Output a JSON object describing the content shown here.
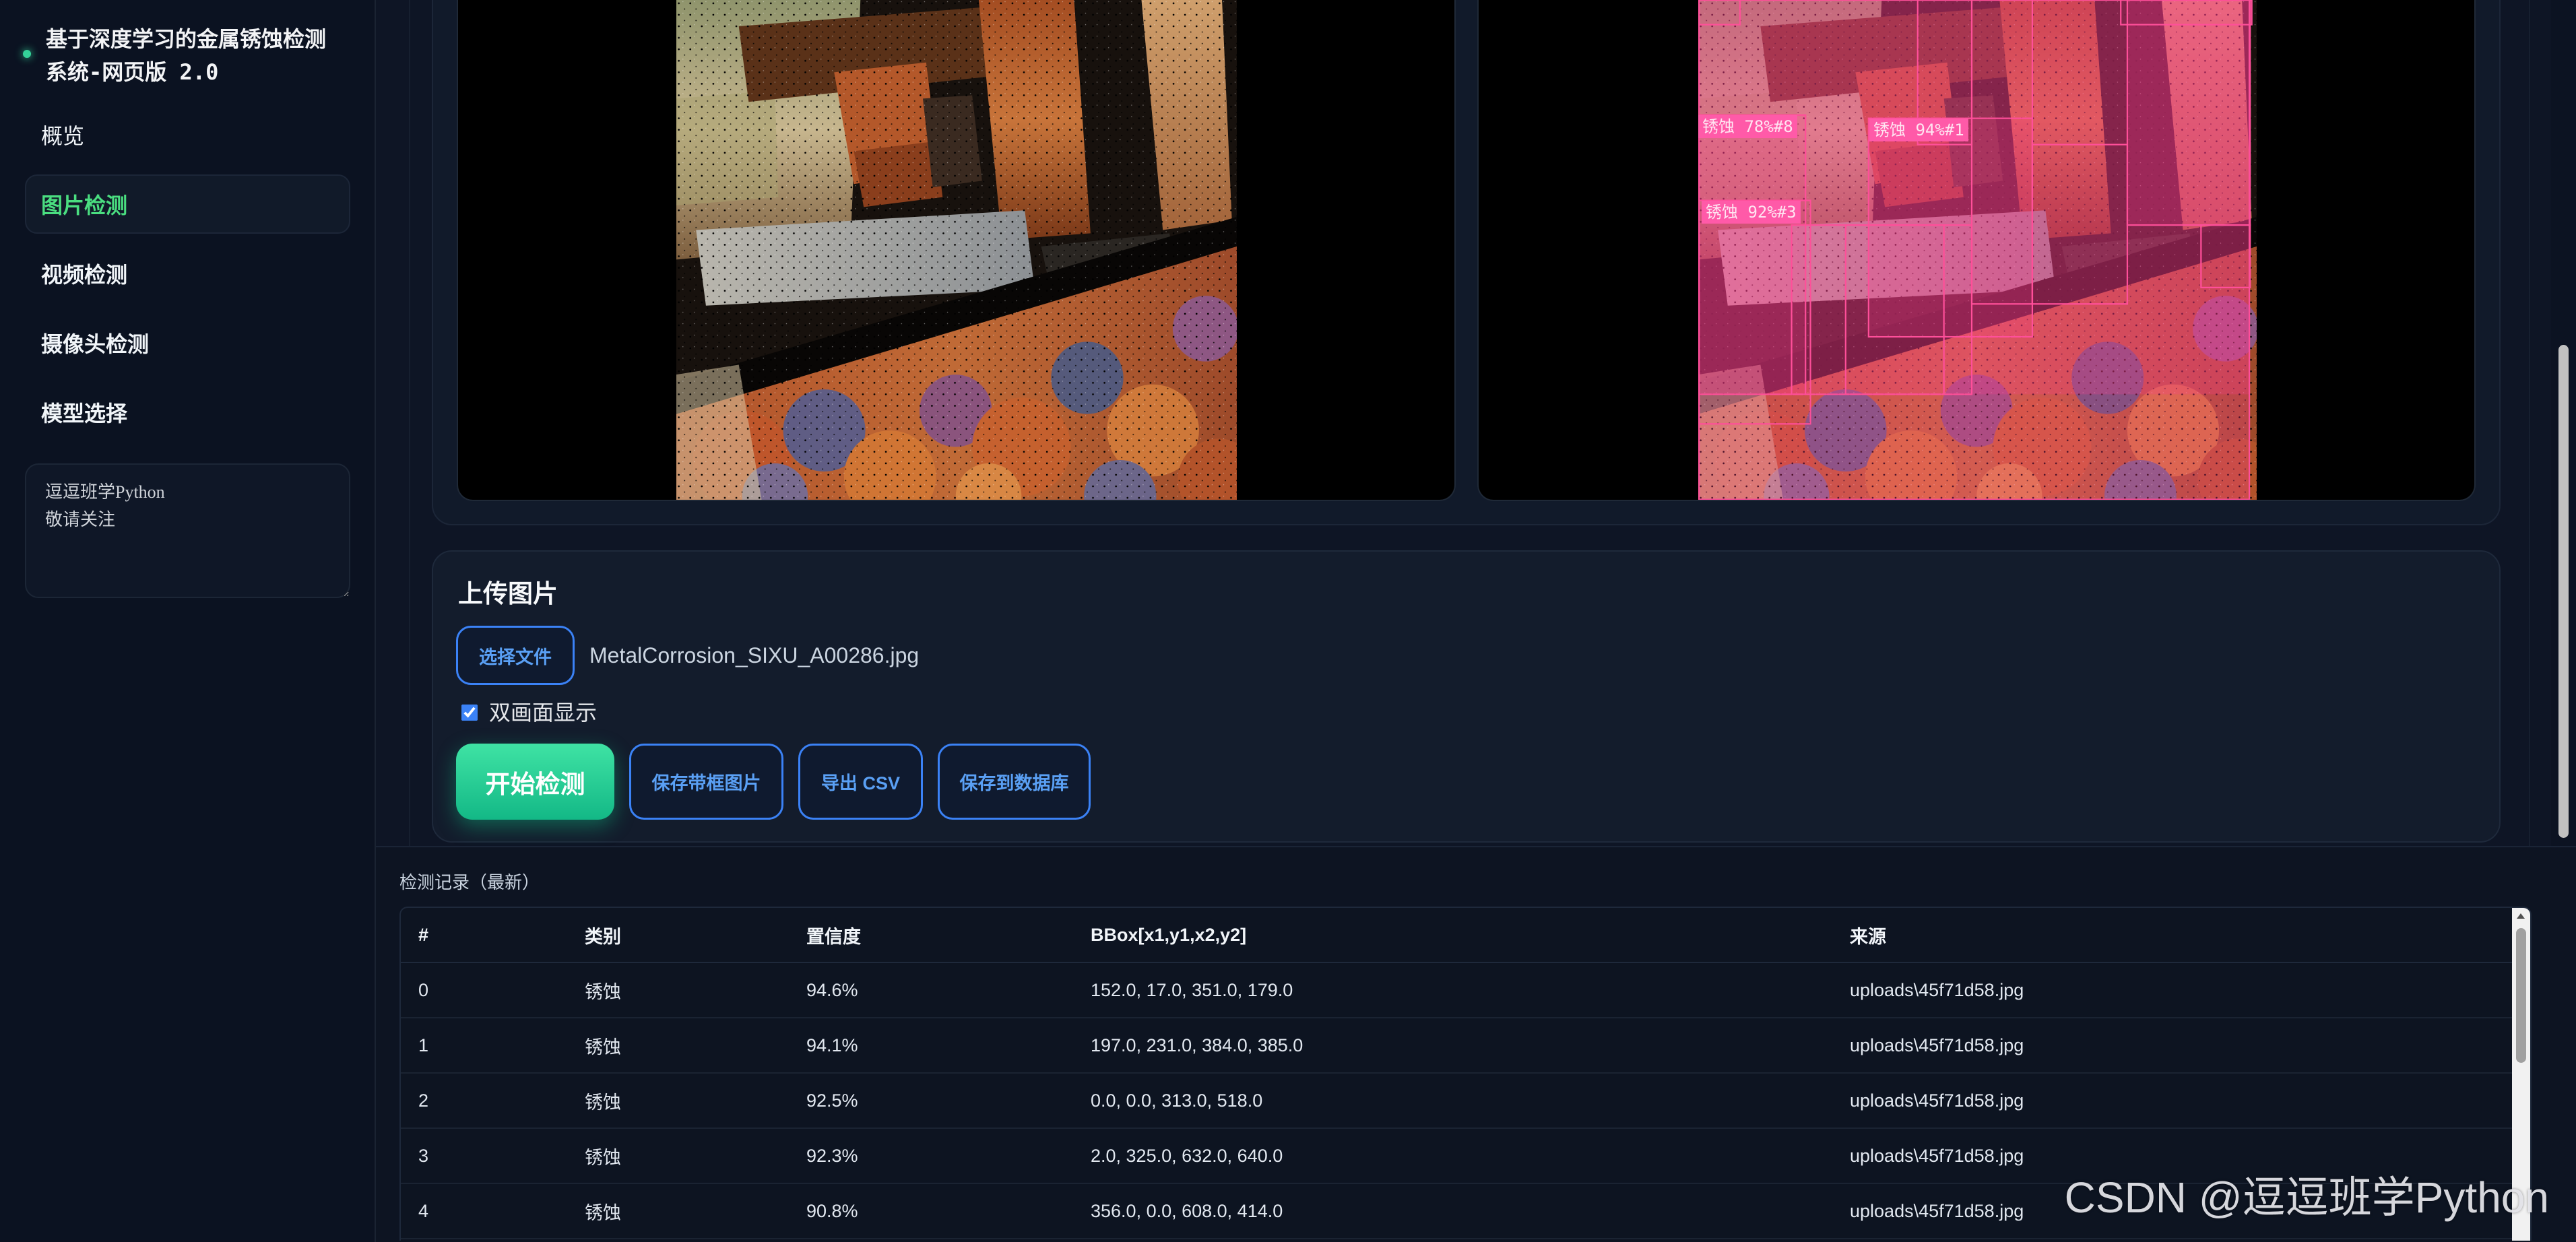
{
  "app": {
    "title": "基于深度学习的金属锈蚀检测系统-网页版 2.0"
  },
  "sidebar": {
    "nav": [
      {
        "label": "概览",
        "active": false
      },
      {
        "label": "图片检测",
        "active": true
      },
      {
        "label": "视频检测",
        "active": false
      },
      {
        "label": "摄像头检测",
        "active": false
      },
      {
        "label": "模型选择",
        "active": false
      }
    ],
    "notes": "逗逗班学Python\n敬请关注"
  },
  "preview": {
    "detections": [
      {
        "label": "锈蚀 78%#8"
      },
      {
        "label": "锈蚀 94%#1"
      },
      {
        "label": "锈蚀 92%#3"
      }
    ]
  },
  "upload": {
    "title": "上传图片",
    "choose_file_label": "选择文件",
    "file_name": "MetalCorrosion_SIXU_A00286.jpg",
    "dual_view_label": "双画面显示",
    "dual_view_checked": true,
    "start_label": "开始检测",
    "save_boxed_label": "保存带框图片",
    "export_csv_label": "导出 CSV",
    "save_db_label": "保存到数据库"
  },
  "records": {
    "title": "检测记录（最新）",
    "columns": [
      "#",
      "类别",
      "置信度",
      "BBox[x1,y1,x2,y2]",
      "来源"
    ],
    "rows": [
      [
        "0",
        "锈蚀",
        "94.6%",
        "152.0, 17.0, 351.0, 179.0",
        "uploads\\45f71d58.jpg"
      ],
      [
        "1",
        "锈蚀",
        "94.1%",
        "197.0, 231.0, 384.0, 385.0",
        "uploads\\45f71d58.jpg"
      ],
      [
        "2",
        "锈蚀",
        "92.5%",
        "0.0, 0.0, 313.0, 518.0",
        "uploads\\45f71d58.jpg"
      ],
      [
        "3",
        "锈蚀",
        "92.3%",
        "2.0, 325.0, 632.0, 640.0",
        "uploads\\45f71d58.jpg"
      ],
      [
        "4",
        "锈蚀",
        "90.8%",
        "356.0, 0.0, 608.0, 414.0",
        "uploads\\45f71d58.jpg"
      ]
    ]
  },
  "watermark": "CSDN @逗逗班学Python",
  "colors": {
    "accent": "#3b82f6",
    "success": "#34d399",
    "active_nav": "#4ade80",
    "detection_box": "#ff4f9a",
    "background": "#0e1525"
  }
}
